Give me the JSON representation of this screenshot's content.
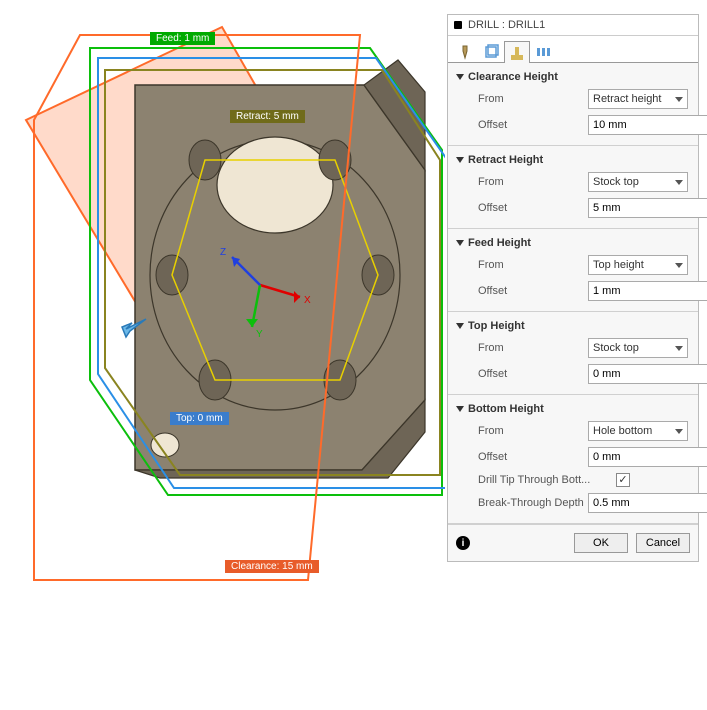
{
  "panel": {
    "title": "DRILL : DRILL1"
  },
  "sections": {
    "clearance": {
      "title": "Clearance Height",
      "from_label": "From",
      "from_value": "Retract height",
      "offset_label": "Offset",
      "offset_value": "10 mm"
    },
    "retract": {
      "title": "Retract Height",
      "from_label": "From",
      "from_value": "Stock top",
      "offset_label": "Offset",
      "offset_value": "5 mm"
    },
    "feed": {
      "title": "Feed Height",
      "from_label": "From",
      "from_value": "Top height",
      "offset_label": "Offset",
      "offset_value": "1 mm"
    },
    "top": {
      "title": "Top Height",
      "from_label": "From",
      "from_value": "Stock top",
      "offset_label": "Offset",
      "offset_value": "0 mm"
    },
    "bottom": {
      "title": "Bottom Height",
      "from_label": "From",
      "from_value": "Hole bottom",
      "offset_label": "Offset",
      "offset_value": "0 mm",
      "drill_tip_label": "Drill Tip Through Bott...",
      "drill_tip_checked": true,
      "break_label": "Break-Through Depth",
      "break_value": "0.5 mm"
    }
  },
  "footer": {
    "ok": "OK",
    "cancel": "Cancel"
  },
  "viewport": {
    "labels": {
      "feed": "Feed: 1 mm",
      "retract": "Retract: 5 mm",
      "top": "Top: 0 mm",
      "clearance": "Clearance: 15 mm"
    },
    "axes": {
      "x": "X",
      "y": "Y",
      "z": "Z"
    }
  }
}
